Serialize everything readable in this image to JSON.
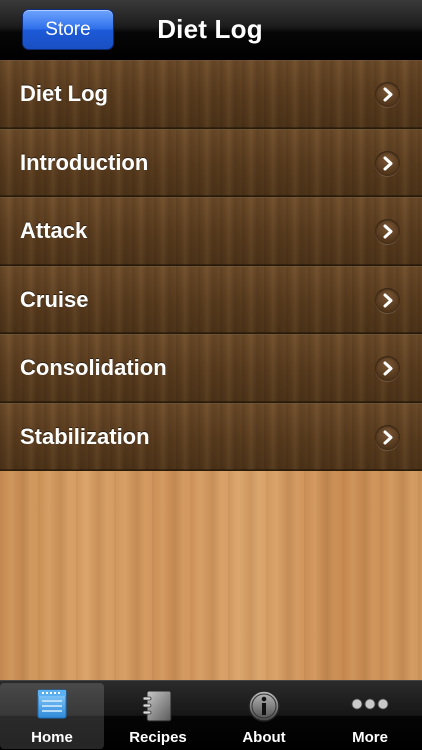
{
  "navbar": {
    "store_label": "Store",
    "title": "Diet Log"
  },
  "list": {
    "items": [
      {
        "label": "Diet Log"
      },
      {
        "label": "Introduction"
      },
      {
        "label": "Attack"
      },
      {
        "label": "Cruise"
      },
      {
        "label": "Consolidation"
      },
      {
        "label": "Stabilization"
      }
    ]
  },
  "tabbar": {
    "tabs": [
      {
        "label": "Home",
        "icon": "home-screen-icon",
        "active": true
      },
      {
        "label": "Recipes",
        "icon": "notebook-icon",
        "active": false
      },
      {
        "label": "About",
        "icon": "info-icon",
        "active": false
      },
      {
        "label": "More",
        "icon": "more-dots-icon",
        "active": false
      }
    ]
  },
  "colors": {
    "store_button": "#2f6fea",
    "row_wood": "#5a3c1e",
    "background_wood": "#d29a60",
    "active_tab_icon": "#4aa8e8"
  }
}
